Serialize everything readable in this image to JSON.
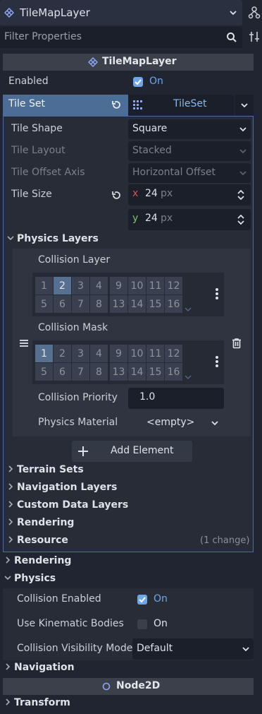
{
  "header": {
    "node_title": "TileMapLayer",
    "filter_placeholder": "Filter Properties"
  },
  "category_title": "TileMapLayer",
  "enabled": {
    "label": "Enabled",
    "value": "On"
  },
  "tileset": {
    "label": "Tile Set",
    "value": "TileSet"
  },
  "tile_shape": {
    "label": "Tile Shape",
    "value": "Square"
  },
  "tile_layout": {
    "label": "Tile Layout",
    "value": "Stacked"
  },
  "tile_offset_axis": {
    "label": "Tile Offset Axis",
    "value": "Horizontal Offset"
  },
  "tile_size": {
    "label": "Tile Size",
    "x_label": "x",
    "x": "24",
    "y_label": "y",
    "y": "24",
    "unit": "px"
  },
  "physics_layers": {
    "title": "Physics Layers",
    "collision_layer_label": "Collision Layer",
    "collision_mask_label": "Collision Mask",
    "bits_a": [
      "1",
      "2",
      "3",
      "4",
      "5",
      "6",
      "7",
      "8"
    ],
    "bits_b": [
      "9",
      "10",
      "11",
      "12",
      "13",
      "14",
      "15",
      "16"
    ],
    "collision_priority_label": "Collision Priority",
    "collision_priority": "1.0",
    "physics_material_label": "Physics Material",
    "physics_material": "<empty>",
    "add_element": "Add Element"
  },
  "tileset_sections": {
    "terrain_sets": "Terrain Sets",
    "navigation_layers": "Navigation Layers",
    "custom_data_layers": "Custom Data Layers",
    "rendering": "Rendering",
    "resource": "Resource",
    "resource_changes": "(1 change)"
  },
  "rendering_section": "Rendering",
  "physics_section": "Physics",
  "collision_enabled": {
    "label": "Collision Enabled",
    "value": "On"
  },
  "use_kinematic": {
    "label": "Use Kinematic Bodies",
    "value": "On"
  },
  "collision_visibility": {
    "label": "Collision Visibility Mode",
    "value": "Default"
  },
  "navigation_section": "Navigation",
  "node2d_title": "Node2D",
  "transform_section": "Transform",
  "colors": {
    "accent": "#6fa7e6",
    "selected_row": "#4b6d96",
    "panel": "#202531"
  }
}
